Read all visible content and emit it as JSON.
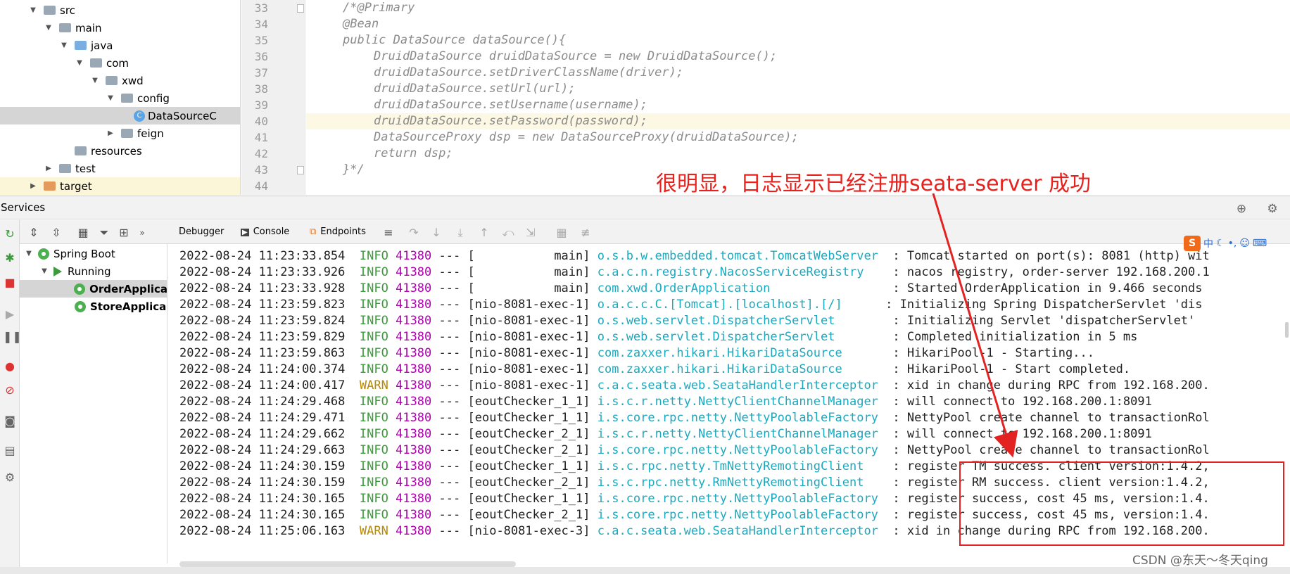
{
  "project_tree": {
    "items": [
      {
        "label": "src",
        "depth": 0,
        "type": "folder",
        "expanded": true
      },
      {
        "label": "main",
        "depth": 1,
        "type": "folder",
        "expanded": true
      },
      {
        "label": "java",
        "depth": 2,
        "type": "folder-blue",
        "expanded": true
      },
      {
        "label": "com",
        "depth": 3,
        "type": "folder",
        "expanded": true
      },
      {
        "label": "xwd",
        "depth": 4,
        "type": "folder",
        "expanded": true
      },
      {
        "label": "config",
        "depth": 5,
        "type": "folder",
        "expanded": true
      },
      {
        "label": "DataSourceC",
        "depth": 6,
        "type": "class",
        "selected": true
      },
      {
        "label": "feign",
        "depth": 5,
        "type": "folder",
        "expanded": false
      },
      {
        "label": "resources",
        "depth": 2,
        "type": "folder",
        "expanded": null
      },
      {
        "label": "test",
        "depth": 1,
        "type": "folder",
        "expanded": false
      },
      {
        "label": "target",
        "depth": 0,
        "type": "folder-orange",
        "expanded": false,
        "highlight": true
      }
    ]
  },
  "editor": {
    "lines": [
      {
        "num": "33",
        "text": "/*@Primary",
        "indent": 0
      },
      {
        "num": "34",
        "text": "@Bean",
        "indent": 0
      },
      {
        "num": "35",
        "text": "public DataSource dataSource(){",
        "indent": 0
      },
      {
        "num": "36",
        "text": "DruidDataSource druidDataSource = new DruidDataSource();",
        "indent": 1
      },
      {
        "num": "37",
        "text": "druidDataSource.setDriverClassName(driver);",
        "indent": 1
      },
      {
        "num": "38",
        "text": "druidDataSource.setUrl(url);",
        "indent": 1
      },
      {
        "num": "39",
        "text": "druidDataSource.setUsername(username);",
        "indent": 1
      },
      {
        "num": "40",
        "text": "druidDataSource.setPassword(password);",
        "indent": 1,
        "current": true
      },
      {
        "num": "41",
        "text": "DataSourceProxy dsp = new DataSourceProxy(druidDataSource);",
        "indent": 1
      },
      {
        "num": "42",
        "text": "return dsp;",
        "indent": 1
      },
      {
        "num": "43",
        "text": "}*/",
        "indent": 0
      },
      {
        "num": "44",
        "text": "",
        "indent": 0
      }
    ]
  },
  "annotation": "很明显，日志显示已经注册seata-server 成功",
  "services": {
    "title": "Services",
    "tabs": [
      {
        "label": "Debugger",
        "icon": "debugger-icon"
      },
      {
        "label": "Console",
        "icon": "console-icon"
      },
      {
        "label": "Endpoints",
        "icon": "endpoints-icon"
      }
    ],
    "tree": [
      {
        "label": "Spring Boot",
        "depth": 0
      },
      {
        "label": "Running",
        "depth": 1
      },
      {
        "label": "OrderApplica",
        "depth": 2,
        "selected": true
      },
      {
        "label": "StoreApplica",
        "depth": 2
      }
    ]
  },
  "console": {
    "lines": [
      {
        "ts": "2022-08-24 11:23:33.854",
        "level": "INFO",
        "pid": "41380",
        "thread": "[           main]",
        "logger": "o.s.b.w.embedded.tomcat.TomcatWebServer ",
        "msg": ": Tomcat started on port(s): 8081 (http) wit"
      },
      {
        "ts": "2022-08-24 11:23:33.926",
        "level": "INFO",
        "pid": "41380",
        "thread": "[           main]",
        "logger": "c.a.c.n.registry.NacosServiceRegistry   ",
        "msg": ": nacos registry, order-server 192.168.200.1"
      },
      {
        "ts": "2022-08-24 11:23:33.928",
        "level": "INFO",
        "pid": "41380",
        "thread": "[           main]",
        "logger": "com.xwd.OrderApplication                ",
        "msg": ": Started OrderApplication in 9.466 seconds"
      },
      {
        "ts": "2022-08-24 11:23:59.823",
        "level": "INFO",
        "pid": "41380",
        "thread": "[nio-8081-exec-1]",
        "logger": "o.a.c.c.C.[Tomcat].[localhost].[/]     ",
        "msg": ": Initializing Spring DispatcherServlet 'dis"
      },
      {
        "ts": "2022-08-24 11:23:59.824",
        "level": "INFO",
        "pid": "41380",
        "thread": "[nio-8081-exec-1]",
        "logger": "o.s.web.servlet.DispatcherServlet       ",
        "msg": ": Initializing Servlet 'dispatcherServlet'"
      },
      {
        "ts": "2022-08-24 11:23:59.829",
        "level": "INFO",
        "pid": "41380",
        "thread": "[nio-8081-exec-1]",
        "logger": "o.s.web.servlet.DispatcherServlet       ",
        "msg": ": Completed initialization in 5 ms"
      },
      {
        "ts": "2022-08-24 11:23:59.863",
        "level": "INFO",
        "pid": "41380",
        "thread": "[nio-8081-exec-1]",
        "logger": "com.zaxxer.hikari.HikariDataSource      ",
        "msg": ": HikariPool-1 - Starting..."
      },
      {
        "ts": "2022-08-24 11:24:00.374",
        "level": "INFO",
        "pid": "41380",
        "thread": "[nio-8081-exec-1]",
        "logger": "com.zaxxer.hikari.HikariDataSource      ",
        "msg": ": HikariPool-1 - Start completed."
      },
      {
        "ts": "2022-08-24 11:24:00.417",
        "level": "WARN",
        "pid": "41380",
        "thread": "[nio-8081-exec-1]",
        "logger": "c.a.c.seata.web.SeataHandlerInterceptor ",
        "msg": ": xid in change during RPC from 192.168.200."
      },
      {
        "ts": "2022-08-24 11:24:29.468",
        "level": "INFO",
        "pid": "41380",
        "thread": "[eoutChecker_1_1]",
        "logger": "i.s.c.r.netty.NettyClientChannelManager ",
        "msg": ": will connect to 192.168.200.1:8091"
      },
      {
        "ts": "2022-08-24 11:24:29.471",
        "level": "INFO",
        "pid": "41380",
        "thread": "[eoutChecker_1_1]",
        "logger": "i.s.core.rpc.netty.NettyPoolableFactory ",
        "msg": ": NettyPool create channel to transactionRol"
      },
      {
        "ts": "2022-08-24 11:24:29.662",
        "level": "INFO",
        "pid": "41380",
        "thread": "[eoutChecker_2_1]",
        "logger": "i.s.c.r.netty.NettyClientChannelManager ",
        "msg": ": will connect to 192.168.200.1:8091"
      },
      {
        "ts": "2022-08-24 11:24:29.663",
        "level": "INFO",
        "pid": "41380",
        "thread": "[eoutChecker_2_1]",
        "logger": "i.s.core.rpc.netty.NettyPoolableFactory ",
        "msg": ": NettyPool create channel to transactionRol"
      },
      {
        "ts": "2022-08-24 11:24:30.159",
        "level": "INFO",
        "pid": "41380",
        "thread": "[eoutChecker_1_1]",
        "logger": "i.s.c.rpc.netty.TmNettyRemotingClient   ",
        "msg": ": register TM success. client version:1.4.2,"
      },
      {
        "ts": "2022-08-24 11:24:30.159",
        "level": "INFO",
        "pid": "41380",
        "thread": "[eoutChecker_2_1]",
        "logger": "i.s.c.rpc.netty.RmNettyRemotingClient   ",
        "msg": ": register RM success. client version:1.4.2,"
      },
      {
        "ts": "2022-08-24 11:24:30.165",
        "level": "INFO",
        "pid": "41380",
        "thread": "[eoutChecker_1_1]",
        "logger": "i.s.core.rpc.netty.NettyPoolableFactory ",
        "msg": ": register success, cost 45 ms, version:1.4."
      },
      {
        "ts": "2022-08-24 11:24:30.165",
        "level": "INFO",
        "pid": "41380",
        "thread": "[eoutChecker_2_1]",
        "logger": "i.s.core.rpc.netty.NettyPoolableFactory ",
        "msg": ": register success, cost 45 ms, version:1.4."
      },
      {
        "ts": "2022-08-24 11:25:06.163",
        "level": "WARN",
        "pid": "41380",
        "thread": "[nio-8081-exec-3]",
        "logger": "c.a.c.seata.web.SeataHandlerInterceptor ",
        "msg": ": xid in change during RPC from 192.168.200."
      }
    ]
  },
  "ime": {
    "lang": "中"
  },
  "watermark": "CSDN @东天～冬天qing",
  "colors": {
    "info": "#3b9c3b",
    "warn": "#b78a00",
    "pid": "#b000b0",
    "logger": "#1ba9bf",
    "annotation": "#e8211c"
  }
}
